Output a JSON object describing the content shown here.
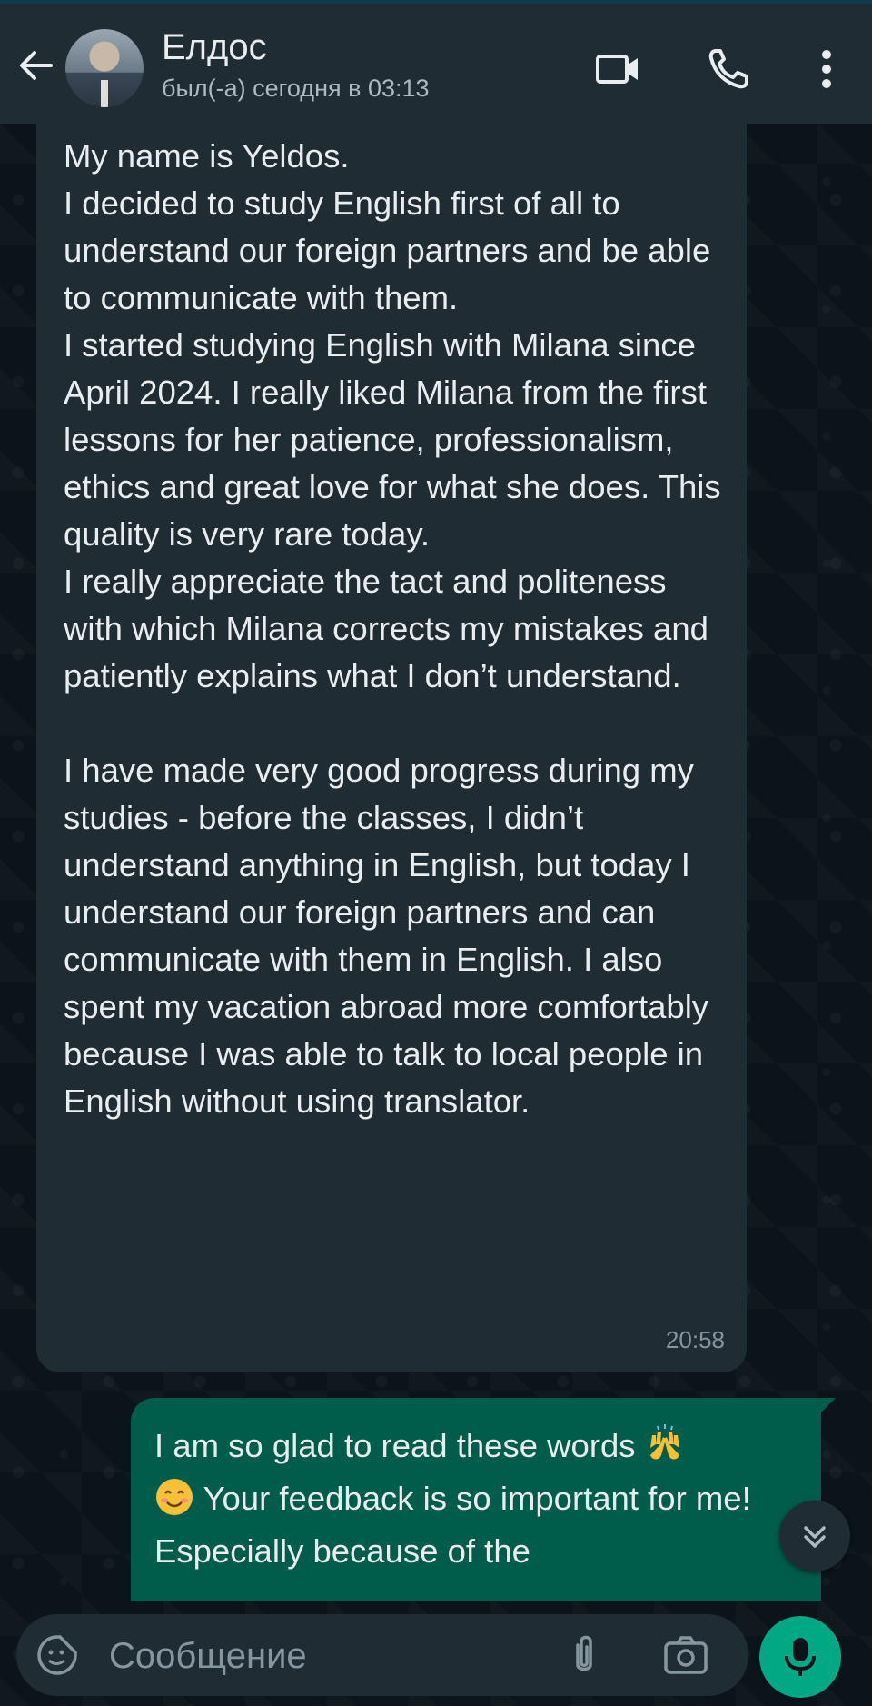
{
  "header": {
    "contact_name": "Елдос",
    "last_seen": "был(-а) сегодня в 03:13",
    "icons": [
      "back-arrow-icon",
      "video-call-icon",
      "phone-call-icon",
      "more-menu-icon"
    ]
  },
  "messages": [
    {
      "direction": "incoming",
      "text": "My name is Yeldos.\nI decided to study English first of all to understand our foreign partners and be able to communicate with them.\nI started studying English with Milana since April 2024. I really liked Milana from the first lessons for her patience, professionalism, ethics and great love for what she does. This quality is very rare today.\nI really appreciate the tact and politeness with which Milana corrects my mistakes and patiently explains what I don’t understand.\n\nI have made very good progress during my studies - before the classes, I didn’t understand anything in English, but today I understand our foreign partners and can communicate with them in English. I also spent my vacation abroad more comfortably because I was able to talk to local people in English without using translator.",
      "time": "20:58"
    },
    {
      "direction": "outgoing",
      "text_part1": "I am so glad to read these words ",
      "emoji1": "raising-hands",
      "text_part2": " Your feedback is so important for me! Especially because of the",
      "emoji2": "smiling-face"
    }
  ],
  "composer": {
    "placeholder": "Сообщение"
  },
  "colors": {
    "background": "#0b141a",
    "header": "#1f2c34",
    "incoming_bubble": "#202c33",
    "outgoing_bubble": "#005c4b",
    "accent": "#00a884"
  }
}
